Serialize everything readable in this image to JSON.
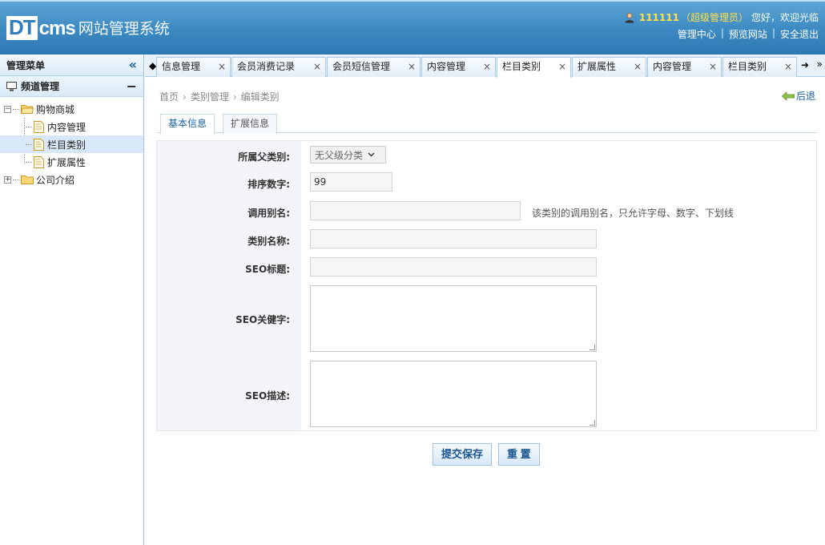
{
  "header": {
    "logo_dt": "DT",
    "logo_cms": "cms",
    "system_title": "网站管理系统",
    "user_name": "111111",
    "user_role": "（超级管理员）",
    "greeting": "您好，欢迎光临",
    "links": [
      "管理中心",
      "预览网站",
      "安全退出"
    ],
    "link_sep": "|"
  },
  "sidebar": {
    "title": "管理菜单",
    "collapse_icon": "«",
    "group": "频道管理",
    "group_toggle": "−",
    "tree": {
      "root1": "购物商城",
      "children": [
        "内容管理",
        "栏目类别",
        "扩展属性"
      ],
      "root2": "公司介绍",
      "active_child": "栏目类别"
    }
  },
  "tabs": {
    "nav_left": "◆",
    "nav_right": "➜",
    "nav_down": "»",
    "items": [
      "信息管理",
      "会员消费记录",
      "会员短信管理",
      "内容管理",
      "栏目类别",
      "扩展属性",
      "内容管理",
      "栏目类别"
    ],
    "active_index": 4,
    "close_glyph": "×"
  },
  "breadcrumb": [
    "首页",
    "类别管理",
    "编辑类别"
  ],
  "back_label": "后退",
  "subtabs": [
    "基本信息",
    "扩展信息"
  ],
  "form": {
    "parent_label": "所属父类别:",
    "parent_value": "无父级分类",
    "sort_label": "排序数字:",
    "sort_value": "99",
    "alias_label": "调用别名:",
    "alias_value": "",
    "alias_hint": "该类别的调用别名，只允许字母、数字、下划线",
    "name_label": "类别名称:",
    "name_value": "",
    "seo_title_label": "SEO标题:",
    "seo_title_value": "",
    "seo_keywords_label": "SEO关健字:",
    "seo_desc_label": "SEO描述:"
  },
  "buttons": {
    "submit": "提交保存",
    "reset": "重 置"
  },
  "colors": {
    "header_blue": "#3f8cc4",
    "user_yellow": "#ffe04a",
    "link_blue": "#1b63a5"
  }
}
